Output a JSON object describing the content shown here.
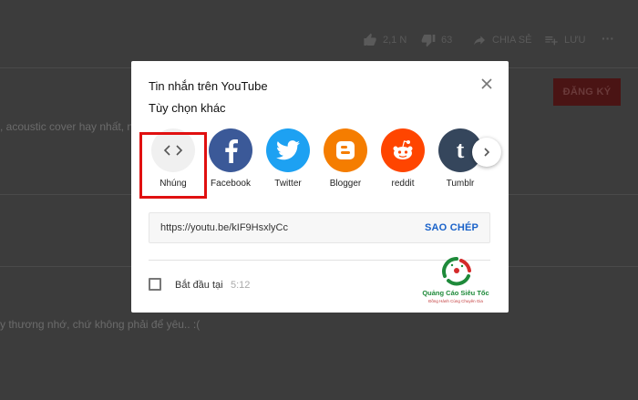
{
  "background": {
    "toolbar": {
      "like_count": "2,1 N",
      "dislike_count": "63",
      "share_label": "CHIA SẺ",
      "save_label": "LƯU",
      "more_label": "···"
    },
    "subscribe_label": "ĐĂNG KÝ",
    "description_line": ", acoustic cover hay nhất, nh",
    "comment_line": "y thương nhớ, chứ không phải để yêu.. :("
  },
  "dialog": {
    "title": "Tin nhắn trên YouTube",
    "subtitle": "Tùy chọn khác",
    "share_targets": [
      {
        "label": "Nhúng",
        "icon": "embed-icon"
      },
      {
        "label": "Facebook",
        "icon": "facebook-icon",
        "color": "#3b5998"
      },
      {
        "label": "Twitter",
        "icon": "twitter-icon",
        "color": "#1da1f2"
      },
      {
        "label": "Blogger",
        "icon": "blogger-icon",
        "color": "#f57d00"
      },
      {
        "label": "reddit",
        "icon": "reddit-icon",
        "color": "#ff4500"
      },
      {
        "label": "Tumblr",
        "icon": "tumblr-icon",
        "color": "#35465c"
      }
    ],
    "share_url": "https://youtu.be/kIF9HsxlyCc",
    "copy_label": "SAO CHÉP",
    "start_at_label": "Bắt đầu tại",
    "start_at_time": "5:12",
    "highlight_color": "#e01010"
  },
  "watermark": {
    "name": "Quảng Cáo Siêu Tốc",
    "tagline": "Đồng Hành Cùng Chuyên Gia"
  }
}
